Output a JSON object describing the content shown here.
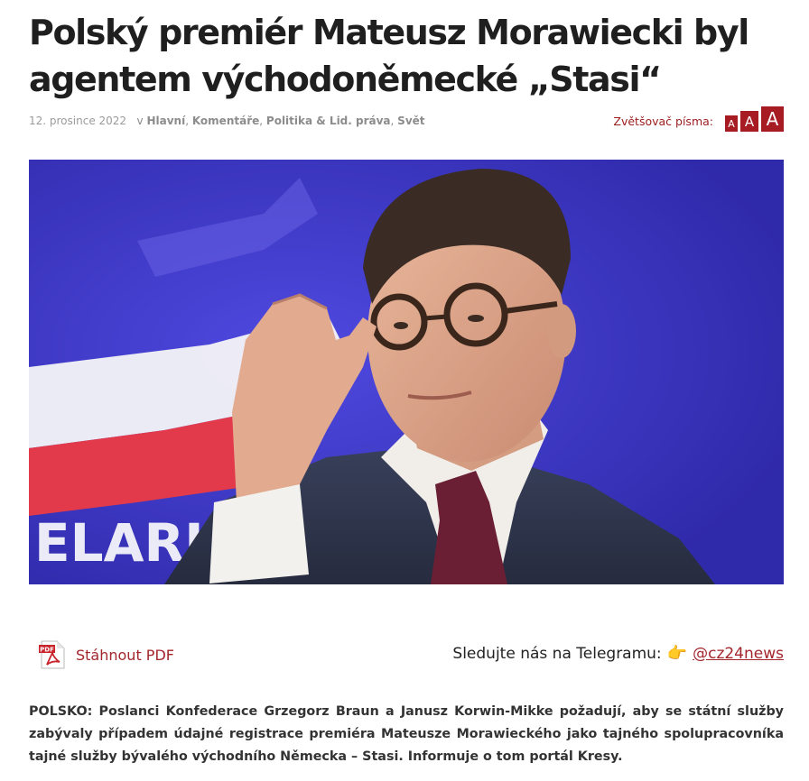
{
  "article": {
    "title": "Polský premiér Mateusz Morawiecki byl agentem východoněmecké „Stasi“",
    "date": "12. prosince 2022",
    "in_prefix": "v",
    "categories": [
      "Hlavní",
      "Komentáře",
      "Politika & Lid. práva",
      "Svět"
    ],
    "lead": "POLSKO: Poslanci Konfederace Grzegorz Braun a Janusz Korwin-Mikke požadují, aby se státní služby zabývaly případem údajné registrace premiéra Mateusze Morawieckého jako tajného spolupracovníka tajné služby bývalého východního Německa – Stasi. Informuje o tom portál Kresy."
  },
  "font_sizer": {
    "label": "Zvětšovač písma:",
    "small": "A",
    "medium": "A",
    "large": "A"
  },
  "hero_image": {
    "background_text": "ELARI"
  },
  "pdf": {
    "icon_text": "PDF",
    "label": "Stáhnout PDF"
  },
  "telegram": {
    "label": "Sledujte nás na Telegramu:",
    "icon": "pointing-hand-icon",
    "handle": "@cz24news"
  },
  "colors": {
    "accent": "#a71c23",
    "hero_bg": "#3b35c9"
  }
}
